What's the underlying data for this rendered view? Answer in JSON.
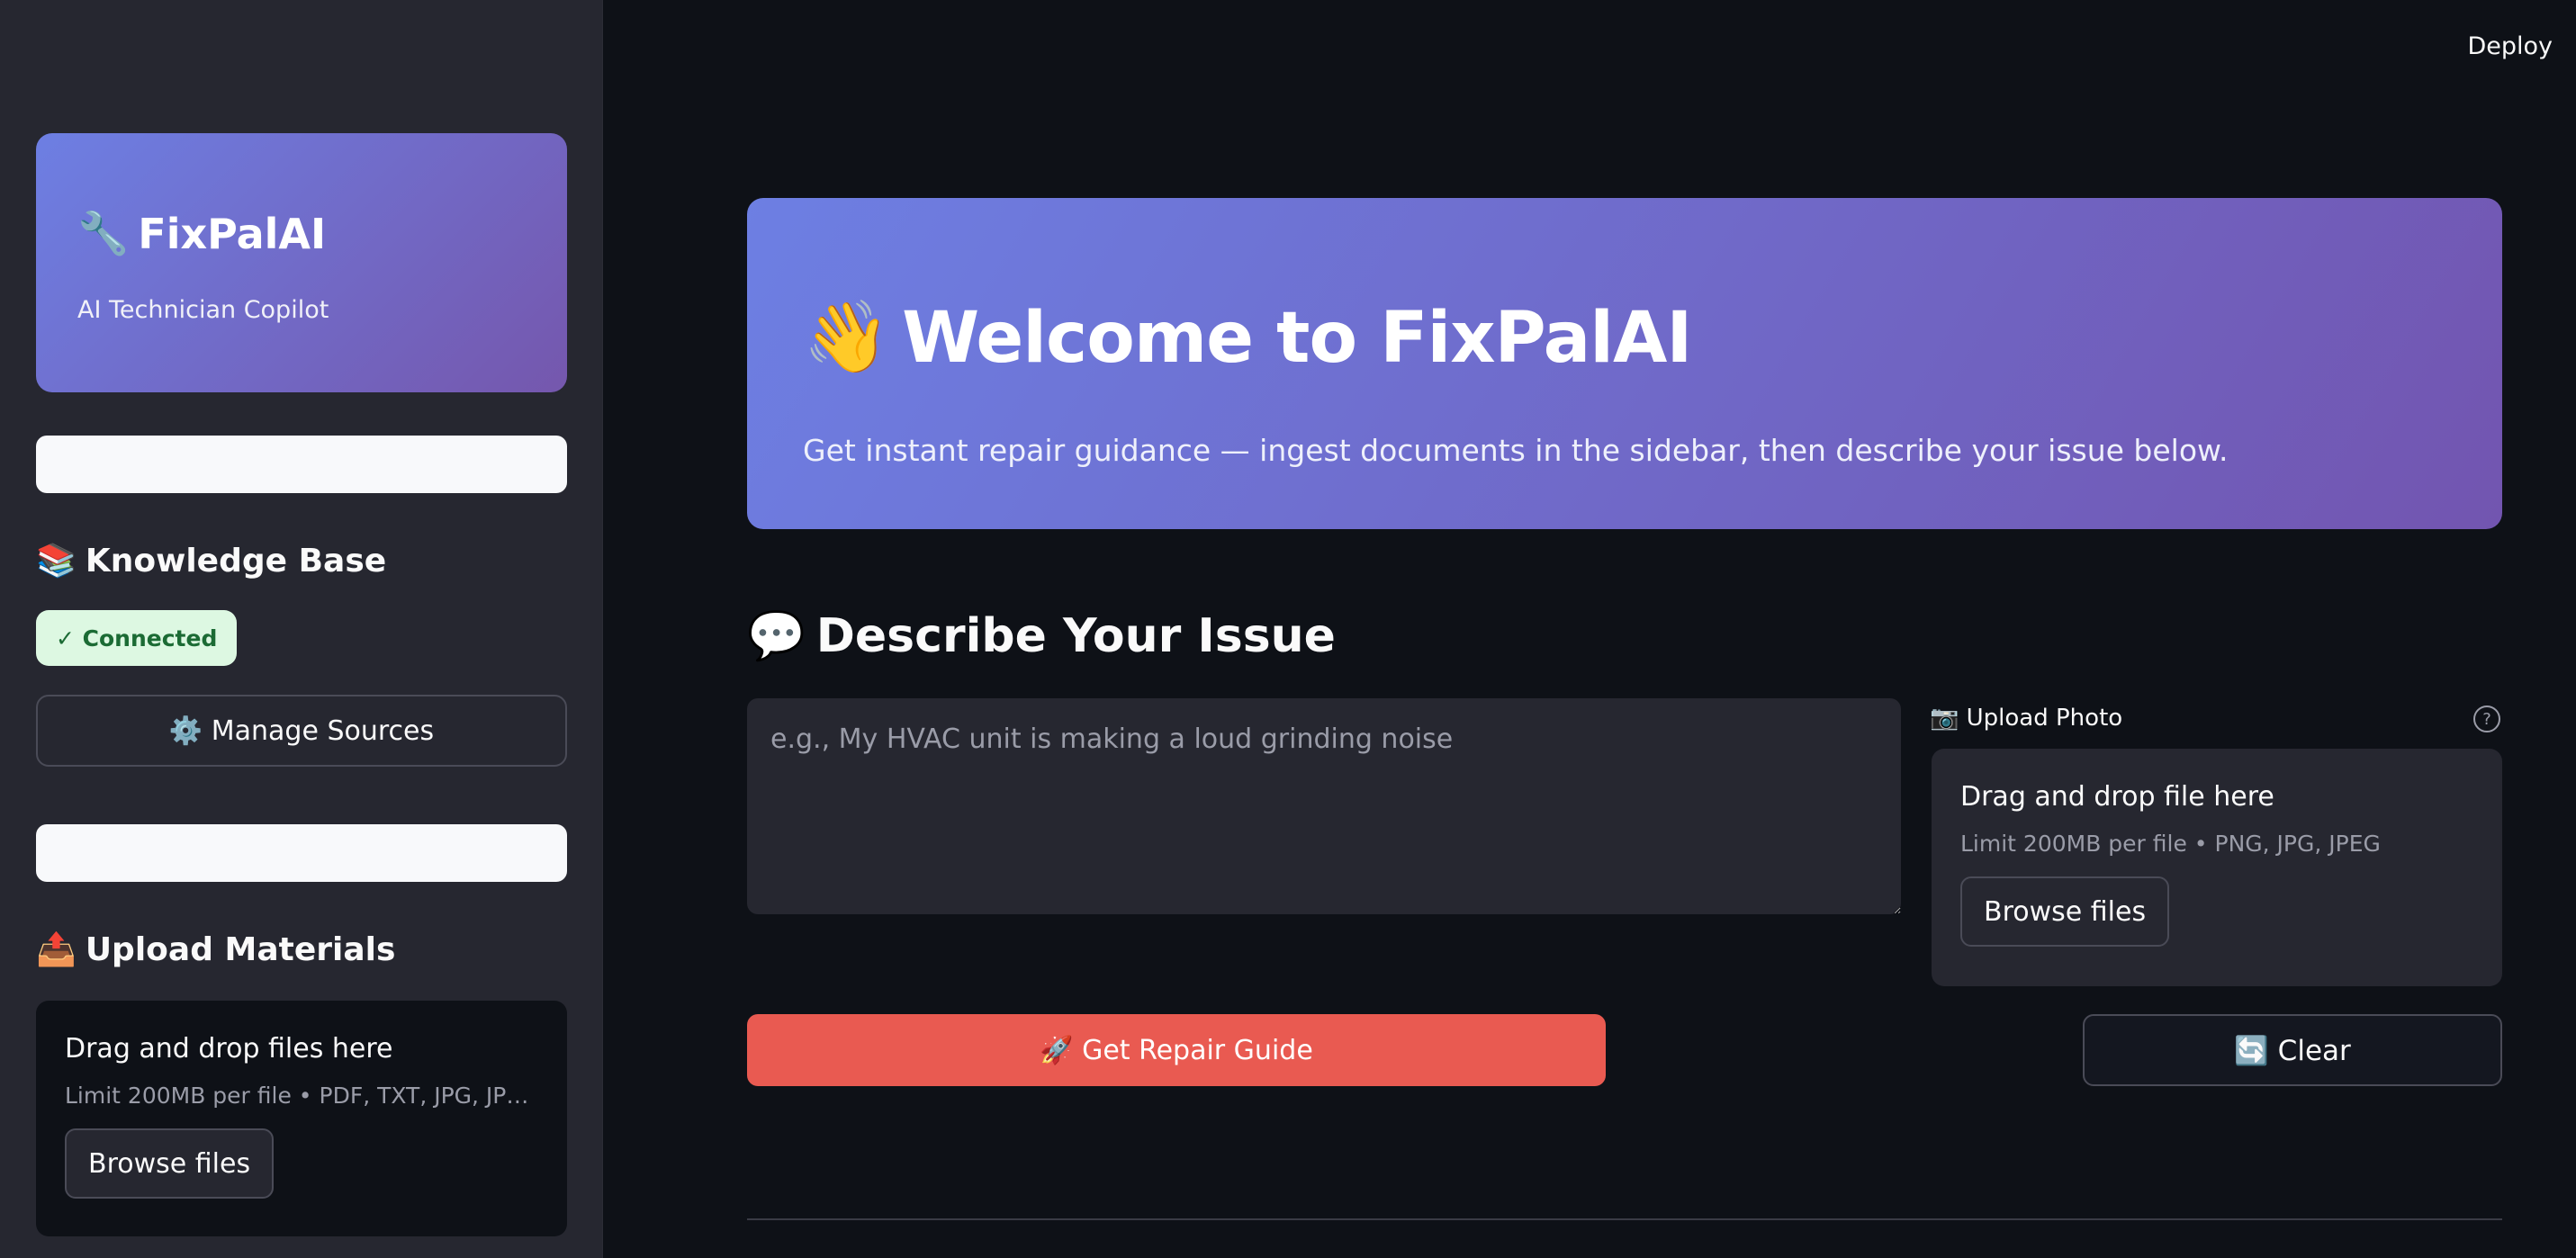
{
  "header": {
    "deploy_label": "Deploy"
  },
  "sidebar": {
    "brand": {
      "icon": "wrench-icon",
      "emoji": "🔧",
      "title": "FixPalAI",
      "subtitle": "AI Technician Copilot"
    },
    "knowledge_base": {
      "emoji": "📚",
      "title": "Knowledge Base",
      "status": "✓ Connected",
      "manage_label": "⚙️ Manage Sources"
    },
    "upload_materials": {
      "emoji": "📤",
      "title": "Upload Materials",
      "dropzone_title": "Drag and drop files here",
      "dropzone_limit": "Limit 200MB per file • PDF, TXT, JPG, JPEG, …",
      "browse_label": "Browse files"
    }
  },
  "main": {
    "hero": {
      "emoji": "👋",
      "title": "Welcome to FixPalAI",
      "subtitle": "Get instant repair guidance — ingest documents in the sidebar, then describe your issue below."
    },
    "describe": {
      "emoji": "💬",
      "title": "Describe Your Issue",
      "placeholder": "e.g., My HVAC unit is making a loud grinding noise",
      "value": ""
    },
    "upload_photo": {
      "label": "📷 Upload Photo",
      "help": "?",
      "dropzone_title": "Drag and drop file here",
      "dropzone_limit": "Limit 200MB per file • PNG, JPG, JPEG",
      "browse_label": "Browse files"
    },
    "actions": {
      "primary_label": "🚀 Get Repair Guide",
      "clear_label": "🔄 Clear"
    }
  },
  "colors": {
    "accent": "#e95a51",
    "gradient_start": "#6d7fe3",
    "gradient_end": "#7557ad",
    "badge_bg": "#ddf8e2",
    "badge_text": "#1b6b34"
  }
}
